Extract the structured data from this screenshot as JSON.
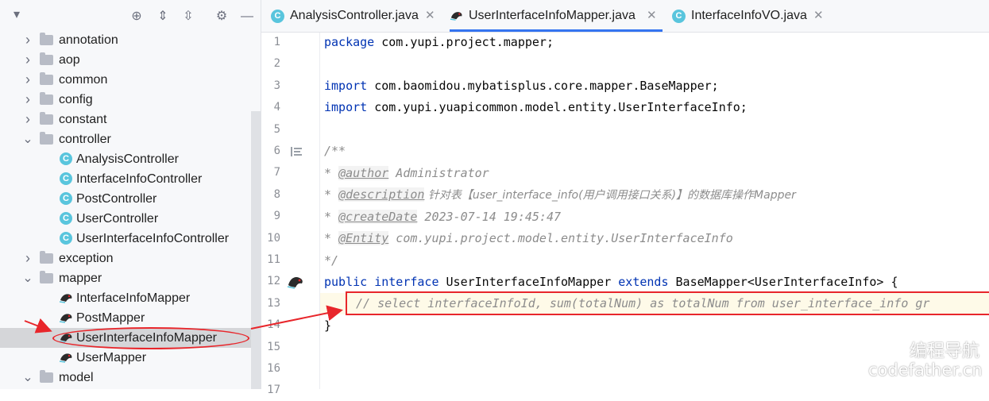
{
  "sidebar": {
    "tree": [
      {
        "label": "annotation",
        "type": "folder",
        "expanded": false
      },
      {
        "label": "aop",
        "type": "folder",
        "expanded": false
      },
      {
        "label": "common",
        "type": "folder",
        "expanded": false
      },
      {
        "label": "config",
        "type": "folder",
        "expanded": false
      },
      {
        "label": "constant",
        "type": "folder",
        "expanded": false
      },
      {
        "label": "controller",
        "type": "folder",
        "expanded": true
      },
      {
        "label": "AnalysisController",
        "type": "class"
      },
      {
        "label": "InterfaceInfoController",
        "type": "class"
      },
      {
        "label": "PostController",
        "type": "class"
      },
      {
        "label": "UserController",
        "type": "class"
      },
      {
        "label": "UserInterfaceInfoController",
        "type": "class"
      },
      {
        "label": "exception",
        "type": "folder",
        "expanded": false
      },
      {
        "label": "mapper",
        "type": "folder",
        "expanded": true
      },
      {
        "label": "InterfaceInfoMapper",
        "type": "mapper"
      },
      {
        "label": "PostMapper",
        "type": "mapper"
      },
      {
        "label": "UserInterfaceInfoMapper",
        "type": "mapper",
        "selected": true
      },
      {
        "label": "UserMapper",
        "type": "mapper"
      },
      {
        "label": "model",
        "type": "folder",
        "expanded": true
      }
    ]
  },
  "tabs": [
    {
      "label": "AnalysisController.java",
      "icon": "class-icon",
      "active": false
    },
    {
      "label": "UserInterfaceInfoMapper.java",
      "icon": "mapper-bird-icon",
      "active": true
    },
    {
      "label": "InterfaceInfoVO.java",
      "icon": "class-icon",
      "active": false
    }
  ],
  "editor": {
    "line_numbers": [
      "1",
      "2",
      "3",
      "4",
      "5",
      "6",
      "7",
      "8",
      "9",
      "10",
      "11",
      "12",
      "13",
      "14",
      "15",
      "16",
      "17"
    ],
    "lines": {
      "l1": {
        "kw": "package",
        "rest": " com.yupi.project.mapper;"
      },
      "l3": {
        "kw": "import",
        "rest": " com.baomidou.mybatisplus.core.mapper.BaseMapper;"
      },
      "l4": {
        "kw": "import",
        "rest": " com.yupi.yuapicommon.model.entity.UserInterfaceInfo;"
      },
      "l6": "/**",
      "l7": {
        "star": "* ",
        "tag": "@author",
        "rest": " Administrator"
      },
      "l8": {
        "star": "* ",
        "tag": "@description",
        "rest": " 针对表【user_interface_info(用户调用接口关系)】的数据库操作Mapper"
      },
      "l9": {
        "star": "* ",
        "tag": "@createDate",
        "rest": " 2023-07-14 19:45:47"
      },
      "l10": {
        "star": "* ",
        "tag": "@Entity",
        "rest": " com.yupi.project.model.entity.UserInterfaceInfo"
      },
      "l11": "*/",
      "l12": {
        "kw1": "public",
        "kw2": "interface",
        "name": " UserInterfaceInfoMapper ",
        "kw3": "extends",
        "rest": " BaseMapper<UserInterfaceInfo> {"
      },
      "l13": "// select interfaceInfoId, sum(totalNum) as totalNum from user_interface_info gr",
      "l14": "}"
    }
  },
  "watermark": {
    "cn": "编程导航",
    "en": "codefather.cn"
  },
  "colors": {
    "keyword": "#0033b3",
    "comment": "#8c8c8c",
    "annotation_red": "#e8262b",
    "tab_accent": "#3574f0"
  }
}
